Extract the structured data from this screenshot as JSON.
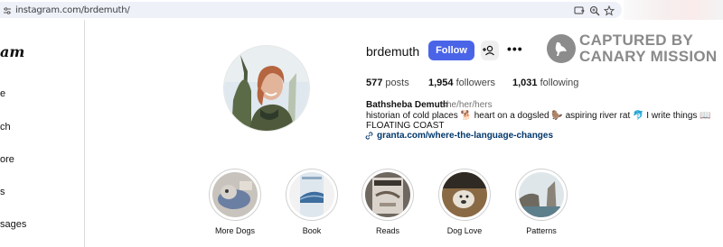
{
  "browser": {
    "url": "instagram.com/brdemuth/",
    "icons": [
      "tune-icon",
      "install-app-icon",
      "zoom-icon",
      "bookmark-star-icon"
    ]
  },
  "sidebar": {
    "logo_text": "am",
    "items": [
      {
        "label": "e"
      },
      {
        "label": "ch"
      },
      {
        "label": "ore"
      },
      {
        "label": "s"
      },
      {
        "label": "sages"
      }
    ]
  },
  "profile": {
    "username": "brdemuth",
    "follow_label": "Follow",
    "more_label": "•••",
    "posts_count": "577",
    "posts_label": "posts",
    "followers_count": "1,954",
    "followers_label": "followers",
    "following_count": "1,031",
    "following_label": "following",
    "full_name": "Bathsheba Demuth",
    "pronouns": "she/her/hers",
    "bio": "historian of cold places 🐕 heart on a dogsled 🦫 aspiring river rat 🐬 I write things 📖 FLOATING COAST",
    "link": "granta.com/where-the-language-changes"
  },
  "watermark": {
    "line1": "CAPTURED BY",
    "line2": "CANARY MISSION"
  },
  "highlights": [
    {
      "label": "More Dogs"
    },
    {
      "label": "Book"
    },
    {
      "label": "Reads"
    },
    {
      "label": "Dog Love"
    },
    {
      "label": "Patterns"
    }
  ],
  "colors": {
    "follow_button": "#4a64e8",
    "link": "#00376b",
    "watermark": "#8a8a8a"
  }
}
